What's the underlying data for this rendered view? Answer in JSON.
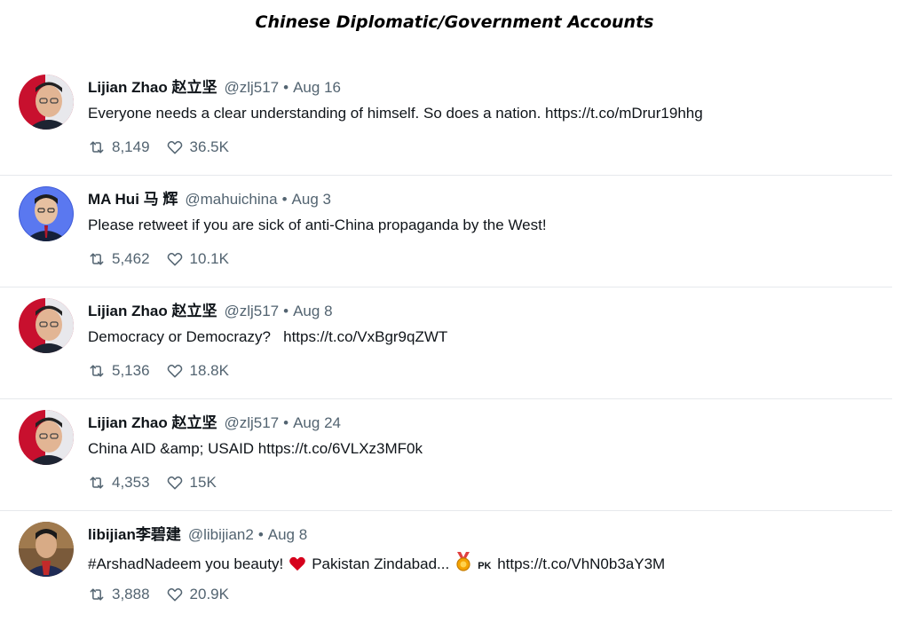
{
  "page": {
    "title": "Chinese Diplomatic/Government Accounts"
  },
  "tweets": [
    {
      "name": "Lijian Zhao 赵立坚",
      "handle": "@zlj517",
      "sep": "•",
      "date": "Aug 16",
      "text": "Everyone needs a clear understanding of himself. So does a nation. https://t.co/mDrur19hhg",
      "retweets": "8,149",
      "likes": "36.5K",
      "avatar": "avatar-lijian-zhao"
    },
    {
      "name": "MA Hui 马 辉",
      "handle": "@mahuichina",
      "sep": "•",
      "date": "Aug 3",
      "text": "Please retweet if you are sick of anti-China propaganda by the West!",
      "retweets": "5,462",
      "likes": "10.1K",
      "avatar": "avatar-ma-hui"
    },
    {
      "name": "Lijian Zhao 赵立坚",
      "handle": "@zlj517",
      "sep": "•",
      "date": "Aug 8",
      "text": "Democracy or Democrazy?   https://t.co/VxBgr9qZWT",
      "retweets": "5,136",
      "likes": "18.8K",
      "avatar": "avatar-lijian-zhao"
    },
    {
      "name": "Lijian Zhao 赵立坚",
      "handle": "@zlj517",
      "sep": "•",
      "date": "Aug 24",
      "text": "China AID &amp; USAID https://t.co/6VLXz3MF0k",
      "retweets": "4,353",
      "likes": "15K",
      "avatar": "avatar-lijian-zhao"
    },
    {
      "name": "libijian李碧建",
      "handle": "@libijian2",
      "sep": "•",
      "date": "Aug 8",
      "text_a": "#ArshadNadeem you beauty!",
      "text_b": "Pakistan Zindabad...",
      "text_pk": "PK",
      "text_c": "https://t.co/VhN0b3aY3M",
      "retweets": "3,888",
      "likes": "20.9K",
      "avatar": "avatar-libijian",
      "emojis": [
        "red-heart-icon",
        "medal-icon"
      ]
    }
  ],
  "colors": {
    "text": "#0f1419",
    "secondary": "#536471",
    "divider": "#e6e9ec",
    "heart": "#d6001c",
    "medal": "#f4a300"
  },
  "icons": {
    "retweet": "retweet-icon",
    "like": "heart-outline-icon"
  }
}
